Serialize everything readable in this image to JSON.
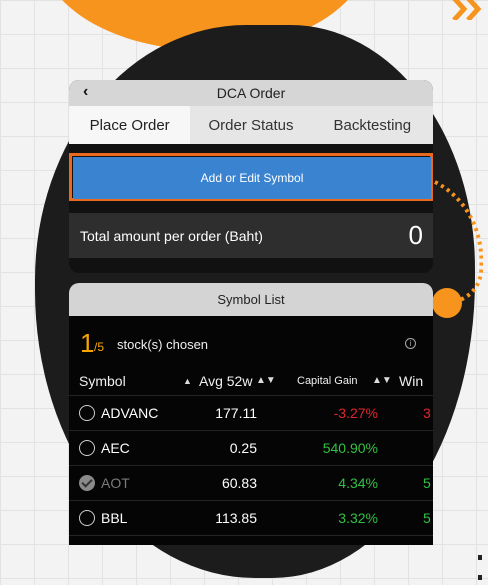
{
  "header": {
    "title": "DCA Order",
    "back_icon": "chevron-left-icon"
  },
  "tabs": [
    {
      "label": "Place Order",
      "active": true
    },
    {
      "label": "Order Status",
      "active": false
    },
    {
      "label": "Backtesting",
      "active": false
    }
  ],
  "add_button": {
    "label": "Add or Edit Symbol"
  },
  "total": {
    "label": "Total amount per order (Baht)",
    "value": "0"
  },
  "symbol_list": {
    "title": "Symbol List",
    "chosen_count": "1",
    "chosen_total": "/5",
    "chosen_text": "stock(s) chosen",
    "info_icon": "i",
    "columns": {
      "symbol": "Symbol",
      "symbol_sort": "▲",
      "avg": "Avg 52w",
      "avg_sort": "▲▼",
      "capital": "Capital Gain",
      "capital_sort": "▲▼",
      "win": "Win"
    },
    "rows": [
      {
        "symbol": "ADVANC",
        "avg": "177.11",
        "capital": "-3.27%",
        "win": "3",
        "color": "#e0262d",
        "checked": false,
        "dim": false
      },
      {
        "symbol": "AEC",
        "avg": "0.25",
        "capital": "540.90%",
        "win": "",
        "color": "#32c043",
        "checked": false,
        "dim": false
      },
      {
        "symbol": "AOT",
        "avg": "60.83",
        "capital": "4.34%",
        "win": "5",
        "color": "#32c043",
        "checked": true,
        "dim": true
      },
      {
        "symbol": "BBL",
        "avg": "113.85",
        "capital": "3.32%",
        "win": "5",
        "color": "#32c043",
        "checked": false,
        "dim": false
      }
    ]
  },
  "colors": {
    "accent": "#f7941d",
    "button": "#3a83d1",
    "highlight_border": "#e86a1f"
  }
}
